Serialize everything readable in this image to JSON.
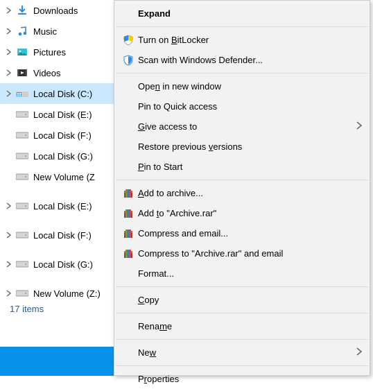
{
  "tree": {
    "items": [
      {
        "label": "Downloads",
        "icon": "download-icon",
        "expandable": true
      },
      {
        "label": "Music",
        "icon": "music-icon",
        "expandable": true
      },
      {
        "label": "Pictures",
        "icon": "pictures-icon",
        "expandable": true
      },
      {
        "label": "Videos",
        "icon": "videos-icon",
        "expandable": true
      },
      {
        "label": "Local Disk (C:)",
        "icon": "osdisk-icon",
        "expandable": true,
        "selected": true
      },
      {
        "label": "Local Disk (E:)",
        "icon": "disk-icon",
        "expandable": false
      },
      {
        "label": "Local Disk (F:)",
        "icon": "disk-icon",
        "expandable": false
      },
      {
        "label": "Local Disk (G:)",
        "icon": "disk-icon",
        "expandable": false
      },
      {
        "label": "New Volume (Z:)",
        "icon": "disk-icon",
        "expandable": false,
        "truncated": "New Volume (Z"
      },
      {
        "gap": true
      },
      {
        "label": "Local Disk (E:)",
        "icon": "disk-icon",
        "expandable": true
      },
      {
        "gap": true
      },
      {
        "label": "Local Disk (F:)",
        "icon": "disk-icon",
        "expandable": true
      },
      {
        "gap": true
      },
      {
        "label": "Local Disk (G:)",
        "icon": "disk-icon",
        "expandable": true
      },
      {
        "gap": true
      },
      {
        "label": "New Volume (Z:)",
        "icon": "disk-icon",
        "expandable": true
      }
    ],
    "status": "17 items"
  },
  "menu": {
    "items": [
      {
        "label": "Expand",
        "bold": true,
        "accel": -1
      },
      {
        "sep": true
      },
      {
        "label": "Turn on BitLocker",
        "icon": "shield-yellow-icon",
        "accel": 8
      },
      {
        "label": "Scan with Windows Defender...",
        "icon": "shield-blue-icon",
        "accel": -1
      },
      {
        "sep": true
      },
      {
        "label": "Open in new window",
        "accel": 3
      },
      {
        "label": "Pin to Quick access",
        "accel": -1
      },
      {
        "label": "Give access to",
        "accel": 0,
        "submenu": true
      },
      {
        "label": "Restore previous versions",
        "accel": 17
      },
      {
        "label": "Pin to Start",
        "accel": 0
      },
      {
        "sep": true
      },
      {
        "label": "Add to archive...",
        "icon": "winrar-icon",
        "accel": 0
      },
      {
        "label": "Add to \"Archive.rar\"",
        "icon": "winrar-icon",
        "accel": 4
      },
      {
        "label": "Compress and email...",
        "icon": "winrar-icon",
        "accel": -1
      },
      {
        "label": "Compress to \"Archive.rar\" and email",
        "icon": "winrar-icon",
        "accel": -1
      },
      {
        "label": "Format...",
        "accel": -1
      },
      {
        "sep": true
      },
      {
        "label": "Copy",
        "accel": 0
      },
      {
        "sep": true
      },
      {
        "label": "Rename",
        "accel": 4
      },
      {
        "sep": true
      },
      {
        "label": "New",
        "accel": 2,
        "submenu": true
      },
      {
        "sep": true
      },
      {
        "label": "Properties",
        "accel": 1
      }
    ]
  },
  "colors": {
    "selection_bg": "#cce8ff",
    "menu_bg": "#f2f2f2",
    "taskbar": "#0592e8"
  }
}
